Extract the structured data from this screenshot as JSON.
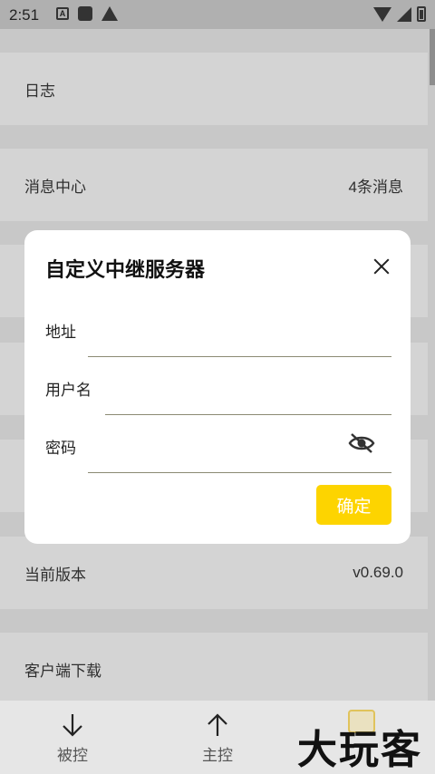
{
  "status_bar": {
    "time": "2:51",
    "a_badge": "A"
  },
  "settings": {
    "items": [
      {
        "label": "日志",
        "value": ""
      },
      {
        "label": "消息中心",
        "value": "4条消息"
      },
      {
        "label": "当前版本",
        "value": "v0.69.0"
      },
      {
        "label": "客户端下载",
        "value": ""
      }
    ]
  },
  "dialog": {
    "title": "自定义中继服务器",
    "fields": [
      {
        "label": "地址",
        "value": ""
      },
      {
        "label": "用户名",
        "value": ""
      },
      {
        "label": "密码",
        "value": ""
      }
    ],
    "confirm_label": "确定",
    "password_toggle_icon": "eye-off-icon",
    "close_icon": "close-icon"
  },
  "bottom_nav": {
    "items": [
      {
        "label": "被控",
        "icon": "arrow-down-icon"
      },
      {
        "label": "主控",
        "icon": "arrow-up-icon"
      }
    ],
    "watermark": "大玩客"
  },
  "colors": {
    "accent": "#fdd400",
    "underline": "#8b8a73"
  }
}
